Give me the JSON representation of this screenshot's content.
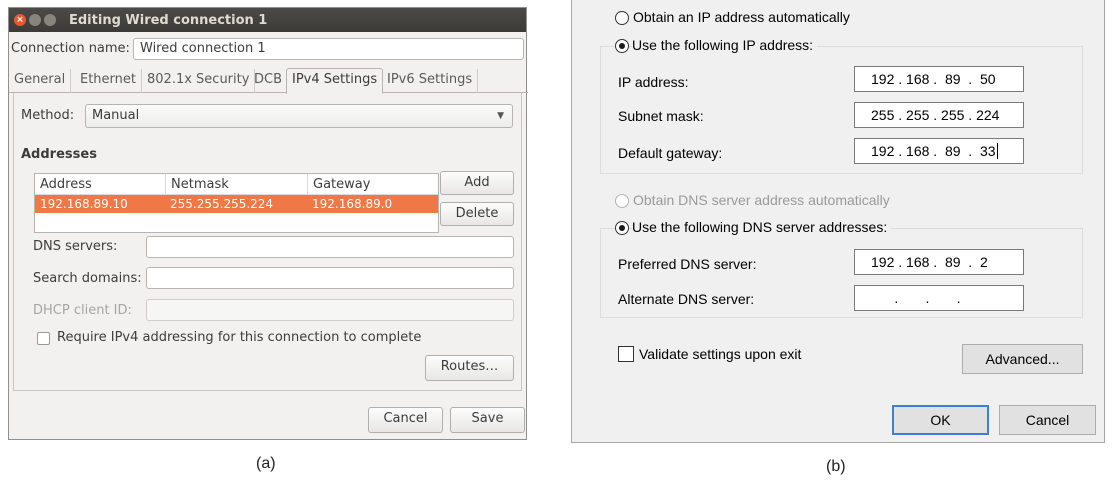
{
  "ubuntu": {
    "window_title": "Editing Wired connection 1",
    "connection_name_label": "Connection name:",
    "connection_name_value": "Wired connection 1",
    "tabs": [
      "General",
      "Ethernet",
      "802.1x Security",
      "DCB",
      "IPv4 Settings",
      "IPv6 Settings"
    ],
    "active_tab": "IPv4 Settings",
    "method_label": "Method:",
    "method_value": "Manual",
    "addresses_heading": "Addresses",
    "table": {
      "headers": [
        "Address",
        "Netmask",
        "Gateway"
      ],
      "rows": [
        [
          "192.168.89.10",
          "255.255.255.224",
          "192.168.89.0"
        ]
      ]
    },
    "add_button": "Add",
    "delete_button": "Delete",
    "dns_servers_label": "DNS servers:",
    "search_domains_label": "Search domains:",
    "dhcp_client_id_label": "DHCP client ID:",
    "require_ipv4_label": "Require IPv4 addressing for this connection to complete",
    "require_ipv4_checked": false,
    "routes_button": "Routes…",
    "cancel_button": "Cancel",
    "save_button": "Save",
    "colors": {
      "titlebar": "#3c3b37",
      "selection": "#f07746",
      "close": "#e9592f"
    }
  },
  "windows": {
    "obtain_ip_auto": "Obtain an IP address automatically",
    "use_following_ip": "Use the following IP address:",
    "ip_address_label": "IP address:",
    "ip_address_value": "192 . 168 .  89  .  50",
    "subnet_mask_label": "Subnet mask:",
    "subnet_mask_value": "255 . 255 . 255 . 224",
    "default_gateway_label": "Default gateway:",
    "default_gateway_value": "192 . 168 .  89  .  33",
    "obtain_dns_auto": "Obtain DNS server address automatically",
    "use_following_dns": "Use the following DNS server addresses:",
    "preferred_dns_label": "Preferred DNS server:",
    "preferred_dns_value": "192 . 168 .  89  .  2",
    "alternate_dns_label": "Alternate DNS server:",
    "alternate_dns_value": "      .       .       .",
    "validate_label": "Validate settings upon exit",
    "validate_checked": false,
    "advanced_button": "Advanced...",
    "ok_button": "OK",
    "cancel_button": "Cancel",
    "colors": {
      "default_button_border": "#3c7fd6"
    }
  },
  "captions": {
    "a": "(a)",
    "b": "(b)"
  }
}
